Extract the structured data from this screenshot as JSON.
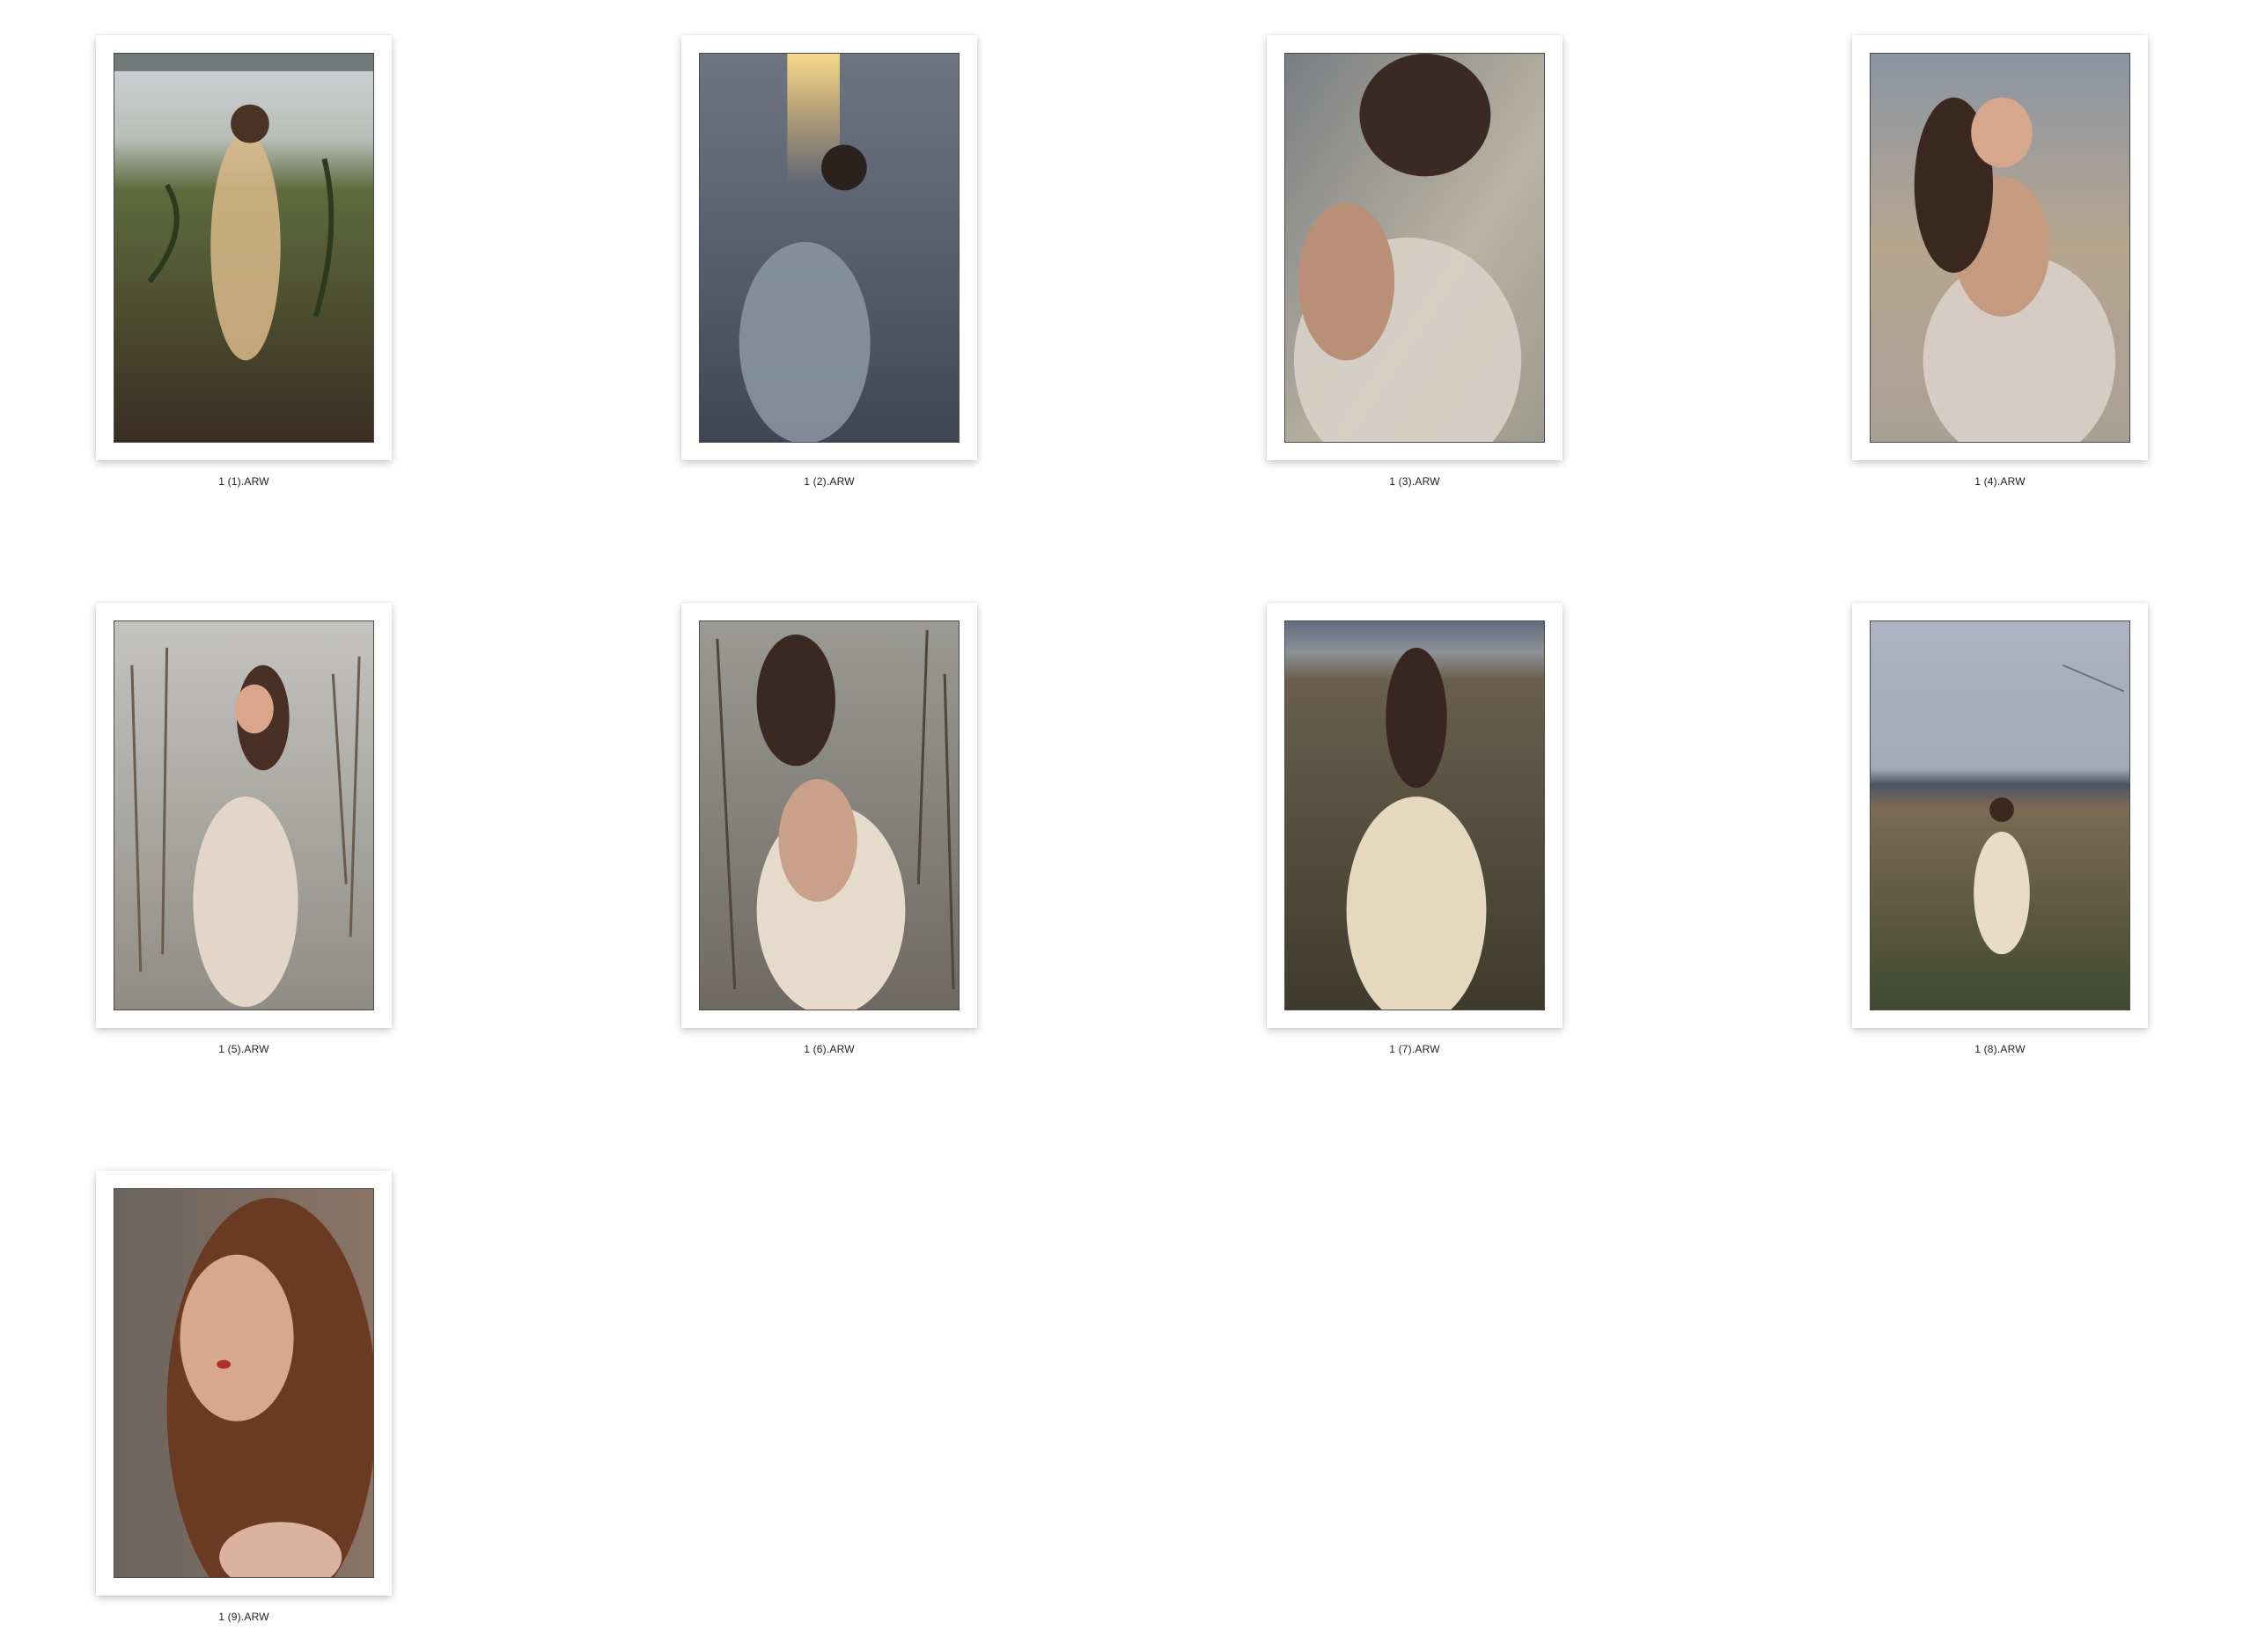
{
  "thumbnails": [
    {
      "filename": "1 (1).ARW"
    },
    {
      "filename": "1 (2).ARW"
    },
    {
      "filename": "1 (3).ARW"
    },
    {
      "filename": "1 (4).ARW"
    },
    {
      "filename": "1 (5).ARW"
    },
    {
      "filename": "1 (6).ARW"
    },
    {
      "filename": "1 (7).ARW"
    },
    {
      "filename": "1 (8).ARW"
    },
    {
      "filename": "1 (9).ARW"
    }
  ]
}
